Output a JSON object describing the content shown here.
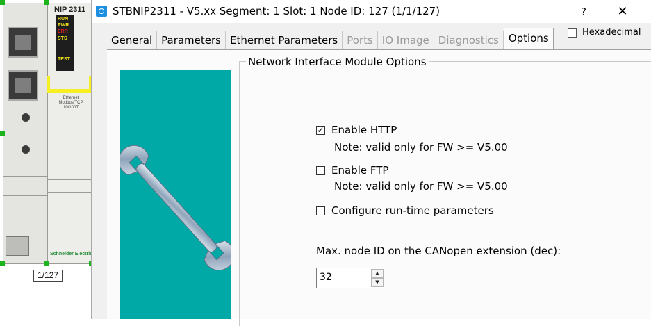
{
  "device": {
    "model_label": "NIP 2311",
    "leds": [
      "RUN",
      "PWR",
      "ERR",
      "STS",
      "TEST"
    ],
    "led_colors": [
      "#f2e218",
      "#f2e218",
      "#e02020",
      "#f2e218",
      "#f2e218"
    ],
    "module_text": "Ethernet Modbus/TCP 10/100T",
    "brand": "Schneider Electric",
    "slot_label": "1/127"
  },
  "dialog": {
    "title": "STBNIP2311 - V5.xx Segment: 1 Slot: 1 Node ID: 127 (1/1/127)",
    "help_label": "?",
    "close_label": "✕",
    "tabs": [
      {
        "label": "General",
        "state": "enabled"
      },
      {
        "label": "Parameters",
        "state": "enabled"
      },
      {
        "label": "Ethernet Parameters",
        "state": "enabled"
      },
      {
        "label": "Ports",
        "state": "disabled"
      },
      {
        "label": "IO Image",
        "state": "disabled"
      },
      {
        "label": "Diagnostics",
        "state": "disabled"
      },
      {
        "label": "Options",
        "state": "active"
      }
    ],
    "hexadecimal": {
      "label": "Hexadecimal",
      "checked": false
    },
    "group_title": "Network Interface Module Options",
    "image_icon": "wrench-icon",
    "options": [
      {
        "label": "Enable HTTP",
        "checked": true,
        "note": "Note: valid only for FW >= V5.00"
      },
      {
        "label": "Enable FTP",
        "checked": false,
        "note": "Note: valid only for FW >= V5.00"
      },
      {
        "label": "Configure run-time parameters",
        "checked": false
      }
    ],
    "max_node": {
      "label": "Max. node ID on the CANopen extension (dec):",
      "value": "32"
    },
    "colors": {
      "panel_accent": "#00a9a5",
      "title_icon": "#1d8fe0",
      "handle": "#1db31d"
    }
  }
}
